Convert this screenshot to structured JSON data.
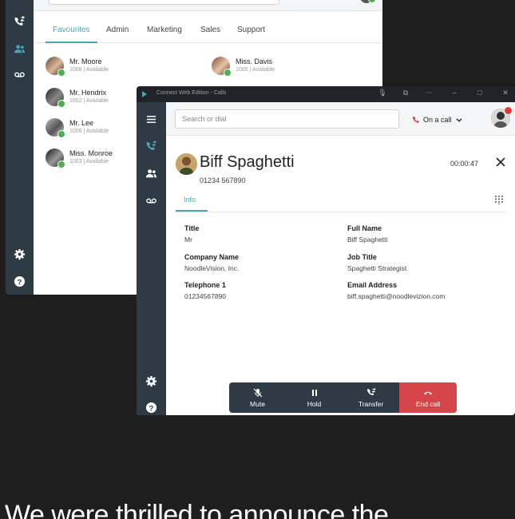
{
  "back_window": {
    "tabs": [
      "Favourites",
      "Admin",
      "Marketing",
      "Sales",
      "Support"
    ],
    "contacts": [
      {
        "name": "Mr. Moore",
        "status": "1008 | Available"
      },
      {
        "name": "Miss. Davis",
        "status": "1005 | Available"
      },
      {
        "name": "Mr. Hendrix",
        "status": "1002 | Available"
      },
      {
        "name": "Mr. Lee",
        "status": "1006 | Available"
      },
      {
        "name": "Miss. Monroe",
        "status": "1003 | Available"
      }
    ],
    "rail_icons": [
      "phone-swap-icon",
      "contacts-icon",
      "voicemail-icon",
      "gear-icon",
      "help-icon"
    ]
  },
  "front_window": {
    "title": "Connect Web Edition - Calls",
    "search_placeholder": "Search or dial",
    "call_status": "On a call",
    "caller": {
      "name": "Biff Spaghetti",
      "number": "01234 567890"
    },
    "timer": "00:00:47",
    "tab": "Info",
    "fields": {
      "title": {
        "label": "Title",
        "value": "Mr"
      },
      "full_name": {
        "label": "Full Name",
        "value": "Biff Spaghetti"
      },
      "company": {
        "label": "Company Name",
        "value": "NoodleVision, Inc."
      },
      "job_title": {
        "label": "Job Title",
        "value": "Spaghetti Strategist"
      },
      "telephone": {
        "label": "Telephone 1",
        "value": "01234567890"
      },
      "email": {
        "label": "Email Address",
        "value": "biff.spaghetti@noodlevizion.com"
      }
    },
    "call_bar": {
      "mute": "Mute",
      "hold": "Hold",
      "transfer": "Transfer",
      "end": "End call"
    }
  },
  "colors": {
    "accent": "#4ba3b8",
    "rail": "#2e3a44",
    "end_call": "#d64549",
    "available": "#4caf50",
    "busy": "#e53935"
  },
  "headline": "We were thrilled to announce the"
}
